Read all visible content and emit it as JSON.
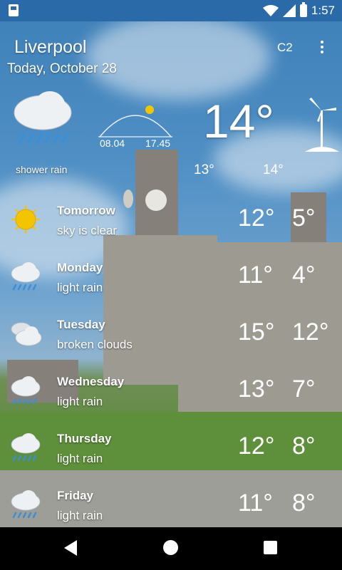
{
  "status_bar": {
    "time": "1:57"
  },
  "header": {
    "city": "Liverpool",
    "date": "Today, October 28",
    "unit_button": "C2"
  },
  "today": {
    "condition": "shower rain",
    "sunrise": "08.04",
    "sunset": "17.45",
    "temp": "14°",
    "low": "13°",
    "high": "14°",
    "icon": "cloud-rain-icon"
  },
  "forecast": [
    {
      "day": "Tomorrow",
      "condition": "sky is clear",
      "high": "12°",
      "low": "5°",
      "icon": "sun-icon"
    },
    {
      "day": "Monday",
      "condition": "light rain",
      "high": "11°",
      "low": "4°",
      "icon": "cloud-rain-icon"
    },
    {
      "day": "Tuesday",
      "condition": "broken clouds",
      "high": "15°",
      "low": "12°",
      "icon": "clouds-icon"
    },
    {
      "day": "Wednesday",
      "condition": "light rain",
      "high": "13°",
      "low": "7°",
      "icon": "cloud-rain-icon"
    },
    {
      "day": "Thursday",
      "condition": "light rain",
      "high": "12°",
      "low": "8°",
      "icon": "cloud-rain-icon"
    },
    {
      "day": "Friday",
      "condition": "light rain",
      "high": "11°",
      "low": "8°",
      "icon": "cloud-rain-icon"
    }
  ],
  "colors": {
    "status_bar": "#2b6aa9",
    "rain_drops": "#3a8fd6",
    "sun": "#f2c500"
  }
}
